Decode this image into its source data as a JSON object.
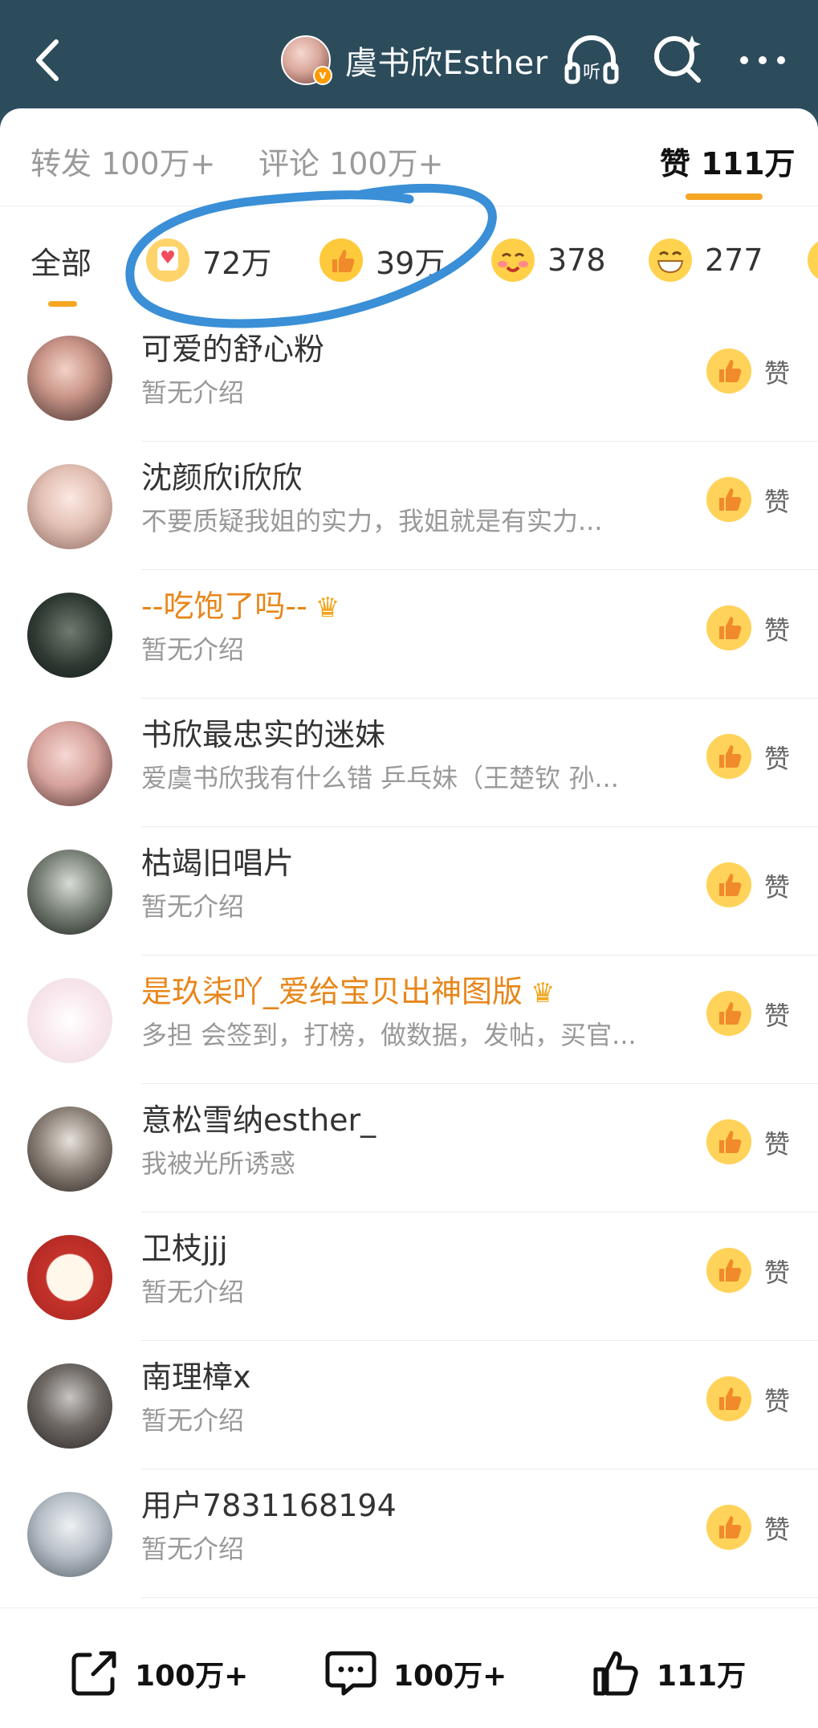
{
  "header": {
    "title": "虞书欣Esther"
  },
  "tabs": {
    "repost": "转发 100万+",
    "comment": "评论 100万+",
    "like": "赞 111万"
  },
  "reactions": {
    "all": "全部",
    "items": [
      {
        "icon": "heart-emoji",
        "count": "72万"
      },
      {
        "icon": "thumbs-up-emoji",
        "count": "39万"
      },
      {
        "icon": "blush-emoji",
        "count": "378"
      },
      {
        "icon": "grin-emoji",
        "count": "277"
      }
    ]
  },
  "like_label": "赞",
  "users": [
    {
      "name": "可爱的舒心粉",
      "desc": "暂无介绍"
    },
    {
      "name": "沈颜欣i欣欣",
      "desc": "不要质疑我姐的实力，我姐就是有实力..."
    },
    {
      "name": "--吃饱了吗--",
      "desc": "暂无介绍"
    },
    {
      "name": "书欣最忠实的迷妹",
      "desc": "爱虞书欣我有什么错 乒乓妹（王楚钦 孙..."
    },
    {
      "name": "枯竭旧唱片",
      "desc": "暂无介绍"
    },
    {
      "name": "是玖柒吖_爱给宝贝出神图版",
      "desc": "多担 会签到，打榜，做数据，发帖，买官..."
    },
    {
      "name": "意松雪纳esther_",
      "desc": "我被光所诱惑"
    },
    {
      "name": "卫枝jjj",
      "desc": "暂无介绍"
    },
    {
      "name": "南理樟x",
      "desc": "暂无介绍"
    },
    {
      "name": "用户7831168194",
      "desc": "暂无介绍"
    }
  ],
  "bottom": {
    "share": "100万+",
    "comment": "100万+",
    "like": "111万"
  },
  "colors": {
    "header_bg": "#2c4c5c",
    "accent": "#f5a623",
    "vip_name": "#e8861a",
    "annotation": "#3a8fd6"
  }
}
